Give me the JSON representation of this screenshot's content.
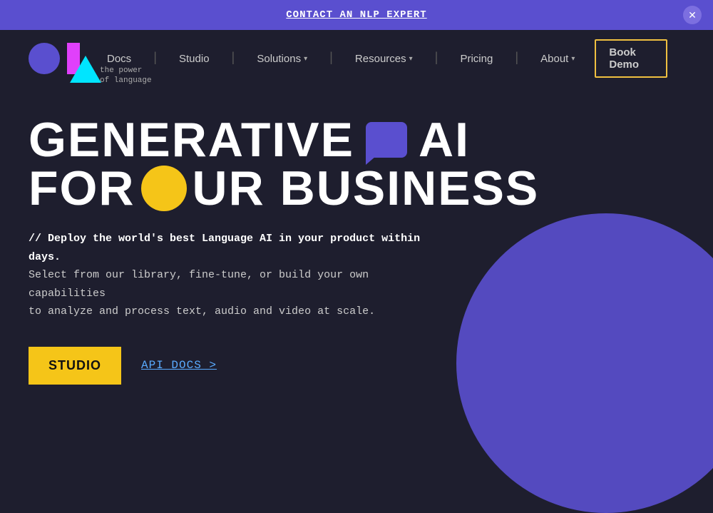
{
  "banner": {
    "cta_text": "CONTACT AN NLP EXPERT",
    "close_label": "✕"
  },
  "nav": {
    "logo_tagline_line1": "the power",
    "logo_tagline_line2": "of language",
    "links": [
      {
        "label": "Docs",
        "has_dropdown": false
      },
      {
        "label": "Studio",
        "has_dropdown": false
      },
      {
        "label": "Solutions",
        "has_dropdown": true
      },
      {
        "label": "Resources",
        "has_dropdown": true
      },
      {
        "label": "Pricing",
        "has_dropdown": false
      },
      {
        "label": "About",
        "has_dropdown": true
      }
    ],
    "book_demo_label": "Book Demo"
  },
  "hero": {
    "title_line1_part1": "GENERATIVE",
    "title_line1_part2": "AI",
    "title_line2_part1": "FOR",
    "title_line2_part2": "UR BUSINESS",
    "subtitle": "// Deploy the world's best Language AI in your product within days.",
    "body_text": "Select from our library, fine-tune, or build your own capabilities\nto analyze and process text, audio and video at scale.",
    "studio_btn_label": "STUDIO",
    "api_docs_label": "API DOCS >"
  }
}
